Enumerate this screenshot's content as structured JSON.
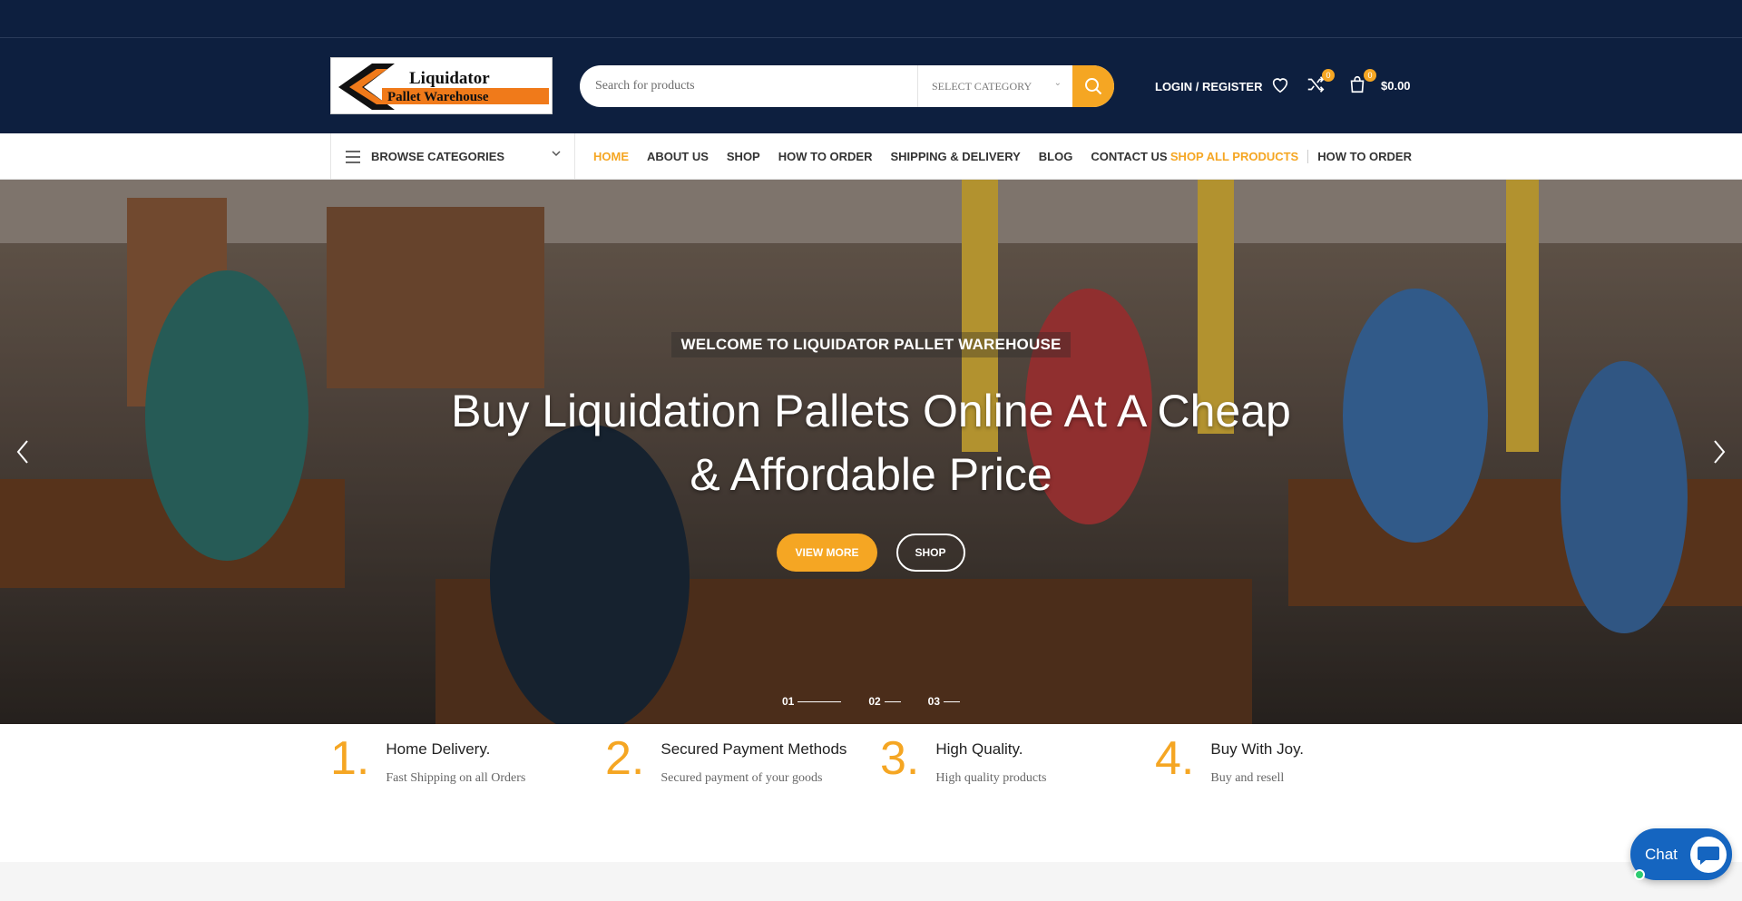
{
  "header": {
    "logo_text_1": "Liquidator",
    "logo_text_2": "Pallet Warehouse",
    "search": {
      "placeholder": "Search for products",
      "category": "SELECT CATEGORY"
    },
    "login_label": "LOGIN / REGISTER",
    "compare_count": "0",
    "cart_count": "0",
    "cart_total": "$0.00"
  },
  "nav": {
    "browse_label": "BROWSE CATEGORIES",
    "links": [
      "HOME",
      "ABOUT US",
      "SHOP",
      "HOW TO ORDER",
      "SHIPPING & DELIVERY",
      "BLOG",
      "CONTACT US"
    ],
    "shop_all": "SHOP ALL PRODUCTS",
    "how_to_order": "HOW TO ORDER"
  },
  "hero": {
    "kicker": "WELCOME TO LIQUIDATOR PALLET WAREHOUSE",
    "title_line1": "Buy Liquidation Pallets Online At A Cheap",
    "title_line2": "& Affordable Price",
    "btn_view": "VIEW MORE",
    "btn_shop": "SHOP",
    "pager": [
      "01",
      "02",
      "03"
    ]
  },
  "features": [
    {
      "num": "1.",
      "title": "Home Delivery.",
      "desc": "Fast Shipping on all Orders"
    },
    {
      "num": "2.",
      "title": "Secured Payment Methods",
      "desc": "Secured payment of your goods"
    },
    {
      "num": "3.",
      "title": "High Quality.",
      "desc": "High quality products"
    },
    {
      "num": "4.",
      "title": "Buy With Joy.",
      "desc": "Buy and resell"
    }
  ],
  "chat": {
    "label": "Chat"
  },
  "colors": {
    "navy": "#0d1f3f",
    "accent": "#f5a623",
    "chat": "#1565c0"
  }
}
